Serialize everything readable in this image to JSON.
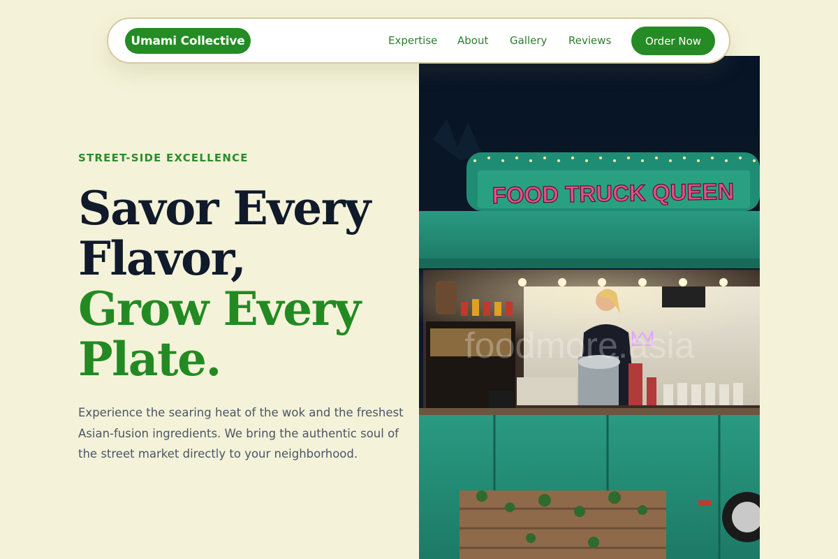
{
  "nav": {
    "brand": "Umami Collective",
    "links": [
      "Expertise",
      "About",
      "Gallery",
      "Reviews"
    ],
    "cta": "Order Now"
  },
  "hero": {
    "eyebrow": "STREET-SIDE EXCELLENCE",
    "headline_line1": "Savor Every",
    "headline_line2": "Flavor,",
    "headline_line3": "Grow Every",
    "headline_line4": "Plate.",
    "description": "Experience the searing heat of the wok and the freshest Asian-fusion ingredients. We bring the authentic soul of the street market directly to your neighborhood."
  },
  "image": {
    "sign_text": "FOOD TRUCK QUEEN",
    "watermark": "foodmore.asia"
  },
  "colors": {
    "background": "#f4f3d9",
    "brand_green": "#258b25",
    "headline_dark": "#101a2b",
    "truck_teal": "#1f8a72"
  }
}
